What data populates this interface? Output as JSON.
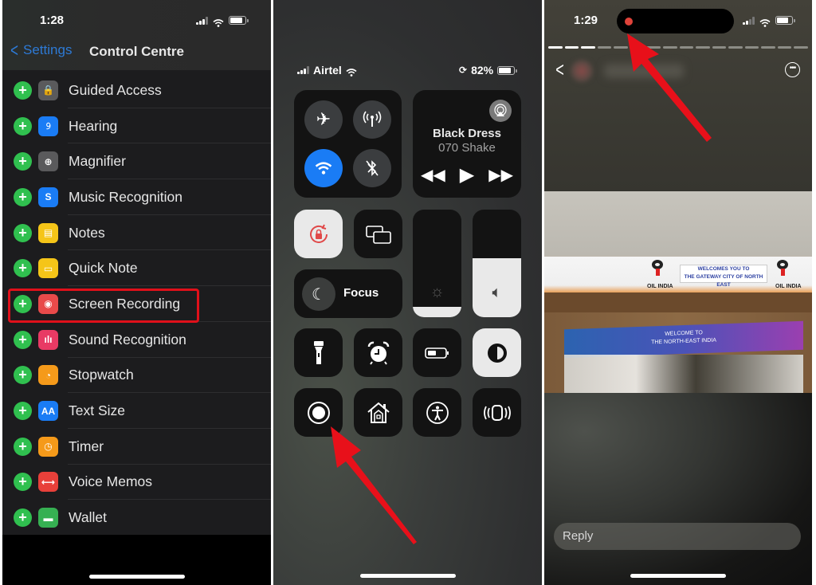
{
  "panel1": {
    "status": {
      "time": "1:28"
    },
    "nav": {
      "back_label": "Settings",
      "title": "Control Centre"
    },
    "items": [
      {
        "label": "Guided Access",
        "icon": "lock-icon",
        "glyph": "🔒",
        "color": "#5a5a5c"
      },
      {
        "label": "Hearing",
        "icon": "ear-icon",
        "glyph": "𝟿",
        "color": "#1a7cf5"
      },
      {
        "label": "Magnifier",
        "icon": "magnifier-icon",
        "glyph": "⊕",
        "color": "#5a5a5c"
      },
      {
        "label": "Music Recognition",
        "icon": "shazam-icon",
        "glyph": "S",
        "color": "#1a7cf5"
      },
      {
        "label": "Notes",
        "icon": "notes-icon",
        "glyph": "▤",
        "color": "#f5c518"
      },
      {
        "label": "Quick Note",
        "icon": "quick-note-icon",
        "glyph": "▭",
        "color": "#f5c518"
      },
      {
        "label": "Screen Recording",
        "icon": "screen-record-icon",
        "glyph": "◉",
        "color": "#e84a4a"
      },
      {
        "label": "Sound Recognition",
        "icon": "sound-wave-icon",
        "glyph": "ılı",
        "color": "#e83a64"
      },
      {
        "label": "Stopwatch",
        "icon": "stopwatch-icon",
        "glyph": "◔",
        "color": "#f59a1a"
      },
      {
        "label": "Text Size",
        "icon": "text-size-icon",
        "glyph": "AA",
        "color": "#1a7cf5"
      },
      {
        "label": "Timer",
        "icon": "timer-icon",
        "glyph": "◷",
        "color": "#f59a1a"
      },
      {
        "label": "Voice Memos",
        "icon": "waveform-icon",
        "glyph": "⟷",
        "color": "#e8403a"
      },
      {
        "label": "Wallet",
        "icon": "wallet-icon",
        "glyph": "▬",
        "color": "#36b052"
      }
    ],
    "highlighted_item": "Screen Recording"
  },
  "panel2": {
    "status": {
      "carrier": "Airtel",
      "battery": "82%"
    },
    "connectivity": {
      "airplane_mode": false,
      "cellular_data": false,
      "wifi": true,
      "bluetooth": false
    },
    "now_playing": {
      "title": "Black Dress",
      "artist": "070 Shake"
    },
    "controls": {
      "focus_label": "Focus",
      "rotation_lock": true,
      "dark_mode": true,
      "brightness_level": 0.1,
      "volume_level": 0.55
    },
    "accent_color": "#1a7cf5"
  },
  "panel3": {
    "status": {
      "time": "1:29",
      "recording": true
    },
    "story_progress": {
      "segments": 16,
      "completed": 3
    },
    "photo_text": {
      "sign_main_line1": "WELCOMES YOU TO",
      "sign_main_line2": "THE GATEWAY CITY OF NORTH EAST",
      "sign_brand": "OIL INDIA",
      "banner_line1": "WELCOME TO",
      "banner_line2": "THE NORTH-EAST INDIA"
    },
    "reply_placeholder": "Reply"
  },
  "annotation_color": "#e0101a"
}
